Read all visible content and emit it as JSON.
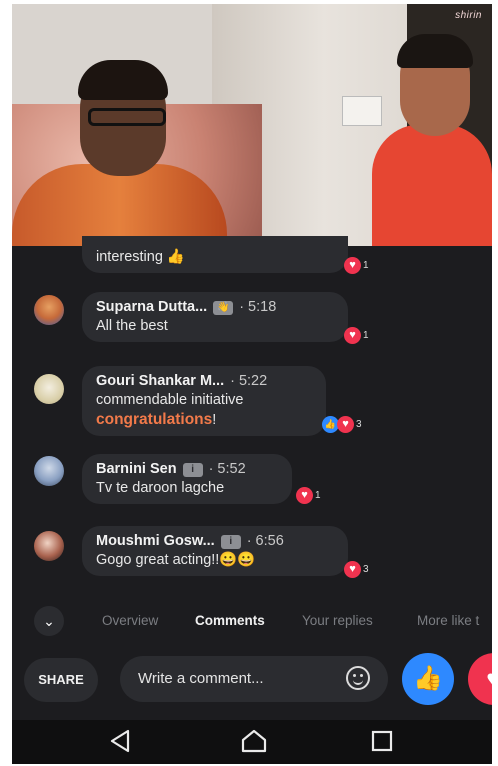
{
  "video": {
    "watermark": "shirin"
  },
  "comments": [
    {
      "name": "",
      "badge": "",
      "time": "",
      "lines": [
        "interesting 👍"
      ],
      "reactions": {
        "types": [
          "love"
        ],
        "count": "1"
      }
    },
    {
      "name": "Suparna Dutta...",
      "badge": "👋",
      "time": "· 5:18",
      "lines": [
        "All the best"
      ],
      "reactions": {
        "types": [
          "love"
        ],
        "count": "1"
      }
    },
    {
      "name": "Gouri Shankar M...",
      "badge": "",
      "time": "· 5:22",
      "lines": [
        "commendable initiative"
      ],
      "highlight": "congratulations",
      "highlight_suffix": "!",
      "reactions": {
        "types": [
          "like",
          "love"
        ],
        "count": "3"
      }
    },
    {
      "name": "Barnini Sen",
      "badge": "i",
      "time": "· 5:52",
      "lines": [
        "Tv te daroon lagche"
      ],
      "reactions": {
        "types": [
          "love"
        ],
        "count": "1"
      }
    },
    {
      "name": "Moushmi Gosw...",
      "badge": "i",
      "time": "· 6:56",
      "lines": [
        "Gogo great acting!!😀😀"
      ],
      "reactions": {
        "types": [
          "love"
        ],
        "count": "3"
      }
    }
  ],
  "tabs": {
    "chevron": "⌄",
    "items": [
      "Overview",
      "Comments",
      "Your replies",
      "More like t"
    ],
    "active": "Comments"
  },
  "actions": {
    "share_label": "SHARE",
    "comment_placeholder": "Write a comment...",
    "like_icon": "👍",
    "love_icon": "♥"
  },
  "nav": {
    "back": "back-icon",
    "home": "home-icon",
    "recents": "recents-icon"
  },
  "colors": {
    "background": "#1c1c1f",
    "bubble": "#2b2c30",
    "highlight": "#f27a4a",
    "like": "#2e89ff",
    "love": "#f0334f"
  }
}
